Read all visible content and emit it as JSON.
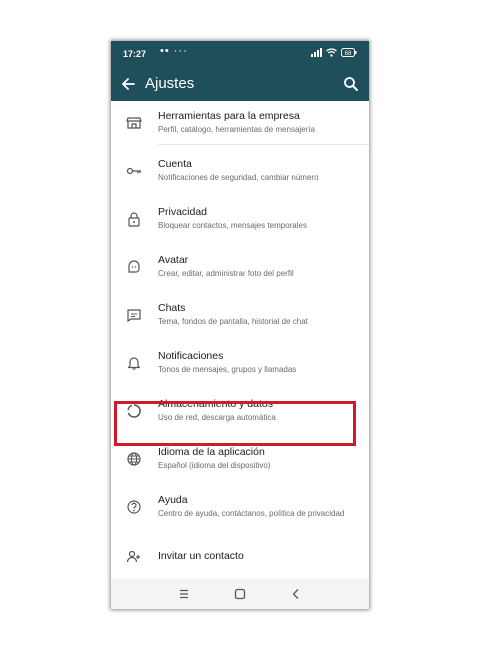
{
  "status_bar": {
    "time": "17:27",
    "dots": "•• ···",
    "battery": "68"
  },
  "app_bar": {
    "title": "Ajustes"
  },
  "settings": [
    {
      "title": "Herramientas para la empresa",
      "subtitle": "Perfil, catálogo, herramientas de mensajería",
      "icon": "store-icon"
    },
    {
      "title": "Cuenta",
      "subtitle": "Notificaciones de seguridad, cambiar número",
      "icon": "key-icon"
    },
    {
      "title": "Privacidad",
      "subtitle": "Bloquear contactos, mensajes temporales",
      "icon": "lock-icon"
    },
    {
      "title": "Avatar",
      "subtitle": "Crear, editar, administrar foto del perfil",
      "icon": "avatar-icon"
    },
    {
      "title": "Chats",
      "subtitle": "Tema, fondos de pantalla, historial de chat",
      "icon": "chat-icon"
    },
    {
      "title": "Notificaciones",
      "subtitle": "Tonos de mensajes, grupos y llamadas",
      "icon": "bell-icon"
    },
    {
      "title": "Almacenamiento y datos",
      "subtitle": "Uso de red, descarga automática",
      "icon": "data-usage-icon"
    },
    {
      "title": "Idioma de la aplicación",
      "subtitle": "Español (idioma del dispositivo)",
      "icon": "globe-icon"
    },
    {
      "title": "Ayuda",
      "subtitle": "Centro de ayuda, contáctanos, política de privacidad",
      "icon": "help-icon"
    },
    {
      "title": "Invitar un contacto",
      "subtitle": "",
      "icon": "invite-contact-icon"
    }
  ],
  "colors": {
    "header": "#1f4f5b",
    "highlight": "#d01b2a"
  }
}
